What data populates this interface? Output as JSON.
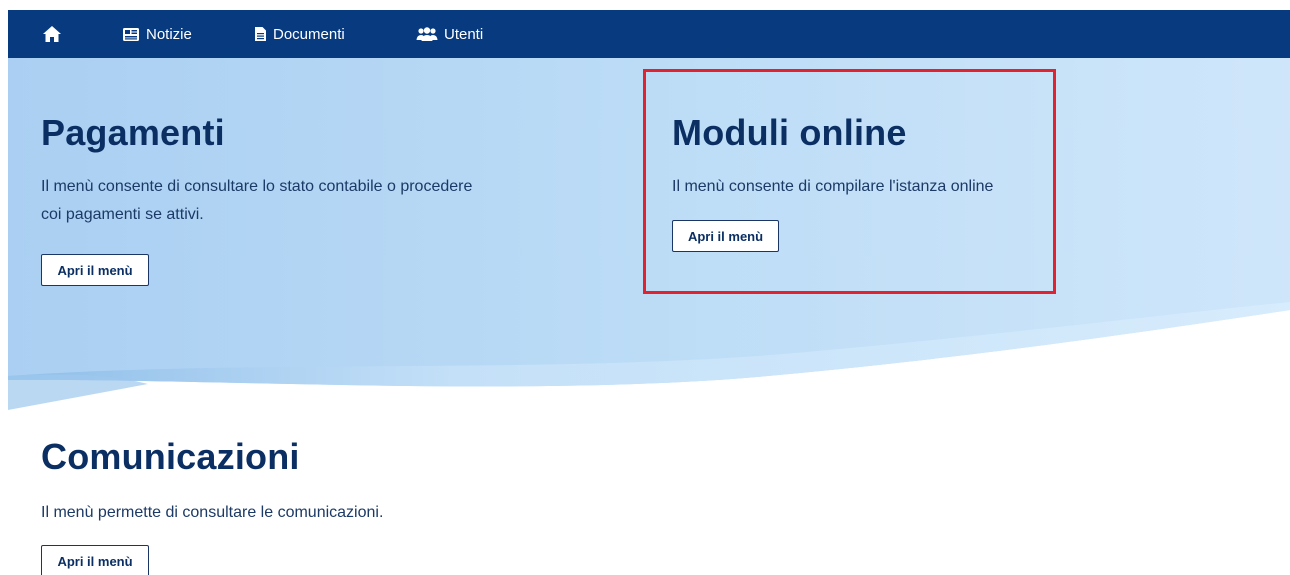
{
  "nav": {
    "home_icon": "home-icon",
    "items": [
      {
        "label": "Notizie",
        "icon": "newspaper-icon"
      },
      {
        "label": "Documenti",
        "icon": "document-icon"
      },
      {
        "label": "Utenti",
        "icon": "users-icon"
      }
    ],
    "bar_color": "#073a7e"
  },
  "sections": {
    "pagamenti": {
      "title": "Pagamenti",
      "text_line1": "Il menù consente di consultare lo stato contabile o procedere",
      "text_line2": "coi pagamenti se attivi.",
      "button_label": "Apri il menù"
    },
    "moduli": {
      "title": "Moduli online",
      "text": "Il menù consente di compilare l'istanza online",
      "button_label": "Apri il menù",
      "highlight_color": "#e2232f"
    },
    "comunicazioni": {
      "title": "Comunicazioni",
      "text": "Il menù permette di consultare le comunicazioni.",
      "button_label": "Apri il menù"
    }
  },
  "colors": {
    "hero_light": "#c9e2f8",
    "hero_mid": "#b3d5f3",
    "title": "#0b2f63"
  }
}
